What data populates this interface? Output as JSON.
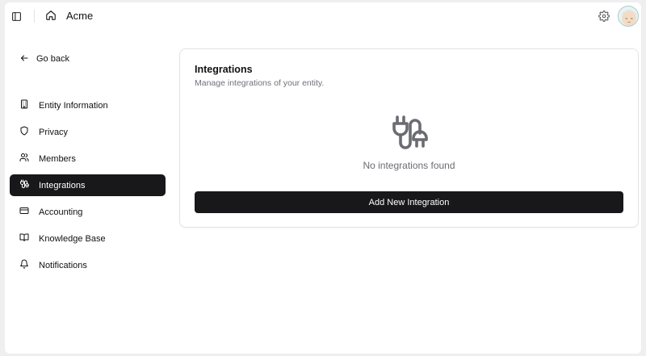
{
  "header": {
    "brand": "Acme",
    "icons": {
      "sidebar_toggle": "panel-left-icon",
      "home": "home-icon",
      "settings": "gear-icon",
      "avatar": "user-avatar"
    }
  },
  "sidebar": {
    "back_label": "Go back",
    "items": [
      {
        "label": "Entity Information",
        "icon": "building-icon",
        "active": false
      },
      {
        "label": "Privacy",
        "icon": "shield-icon",
        "active": false
      },
      {
        "label": "Members",
        "icon": "users-icon",
        "active": false
      },
      {
        "label": "Integrations",
        "icon": "plug-icon",
        "active": true
      },
      {
        "label": "Accounting",
        "icon": "credit-card-icon",
        "active": false
      },
      {
        "label": "Knowledge Base",
        "icon": "book-icon",
        "active": false
      },
      {
        "label": "Notifications",
        "icon": "bell-icon",
        "active": false
      }
    ]
  },
  "main": {
    "title": "Integrations",
    "subtitle": "Manage integrations of your entity.",
    "empty_state": "No integrations found",
    "add_button_label": "Add New Integration"
  },
  "colors": {
    "active_bg": "#18181b",
    "muted_text": "#71717a",
    "border": "#e3e3e7"
  }
}
